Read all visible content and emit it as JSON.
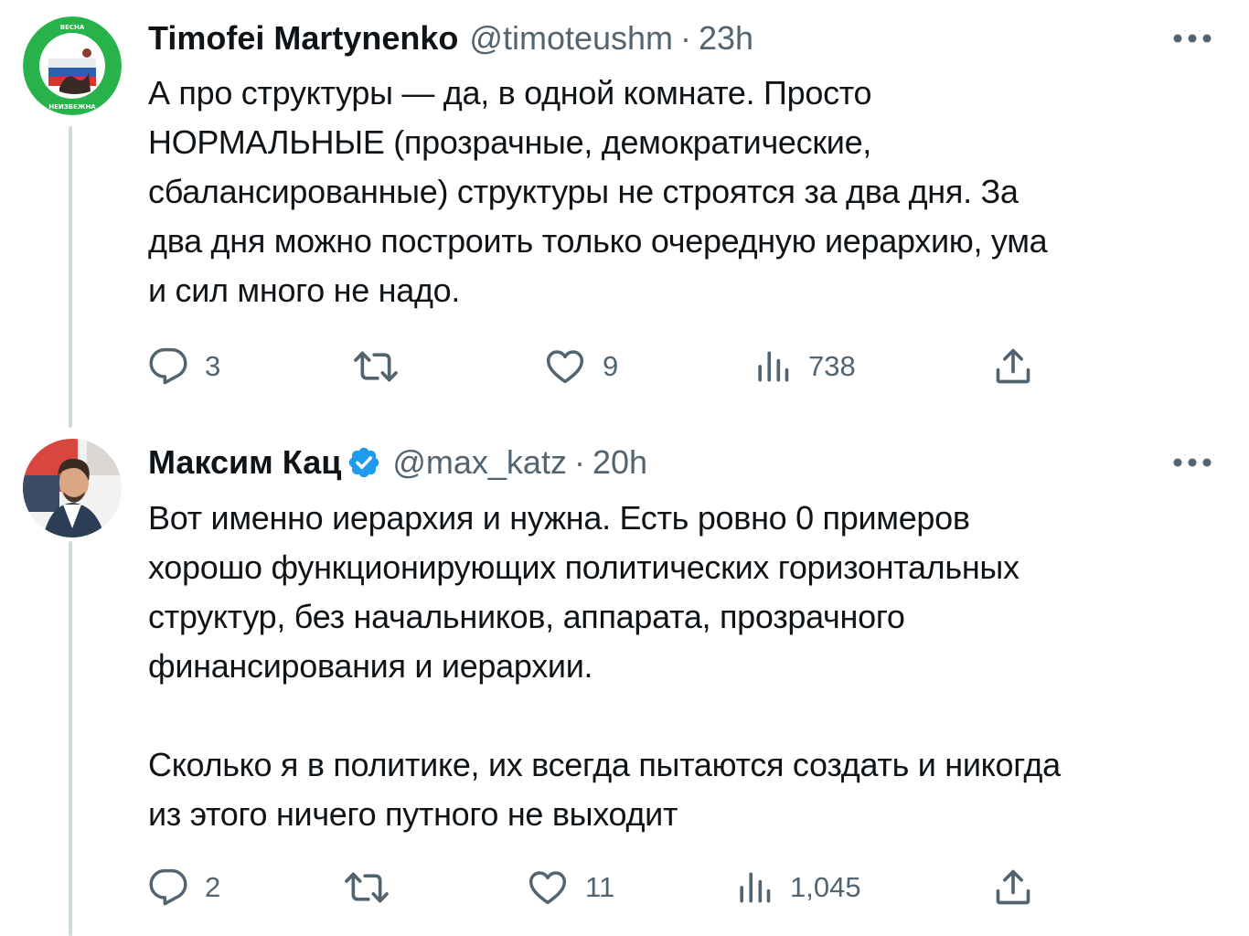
{
  "tweets": [
    {
      "author": {
        "name": "Timofei Martynenko",
        "handle": "@timoteushm",
        "verified": false
      },
      "time": "23h",
      "text": "А про структуры — да, в одной комнате. Просто\nНОРМАЛЬНЫЕ (прозрачные, демократические,\nсбалансированные) структуры не строятся за два дня. За\nдва дня можно построить только очередную иерархию, ума\nи сил много не надо.",
      "stats": {
        "replies": "3",
        "retweets": "",
        "likes": "9",
        "views": "738"
      },
      "avatar_ring_text": "ВЕСНАНЕИЗБЕЖНА"
    },
    {
      "author": {
        "name": "Максим Кац",
        "handle": "@max_katz",
        "verified": true
      },
      "time": "20h",
      "text": "Вот именно иерархия и нужна. Есть ровно 0 примеров\nхорошо функционирующих политических горизонтальных\nструктур, без начальников, аппарата, прозрачного\nфинансирования и иерархии.\n\nСколько я в политике, их всегда пытаются создать и никогда\nиз этого ничего путного не выходит",
      "stats": {
        "replies": "2",
        "retweets": "",
        "likes": "11",
        "views": "1,045"
      }
    }
  ],
  "icons": {
    "reply": "reply-icon",
    "retweet": "retweet-icon",
    "like": "heart-icon",
    "views": "views-icon",
    "share": "share-icon",
    "more": "more-icon",
    "verified": "verified-badge-icon"
  },
  "colors": {
    "text": "#0f1419",
    "secondary": "#536471",
    "verified": "#1d9bf0",
    "thread_line": "#cfd9de",
    "avatar_ring": "#27b34a"
  }
}
